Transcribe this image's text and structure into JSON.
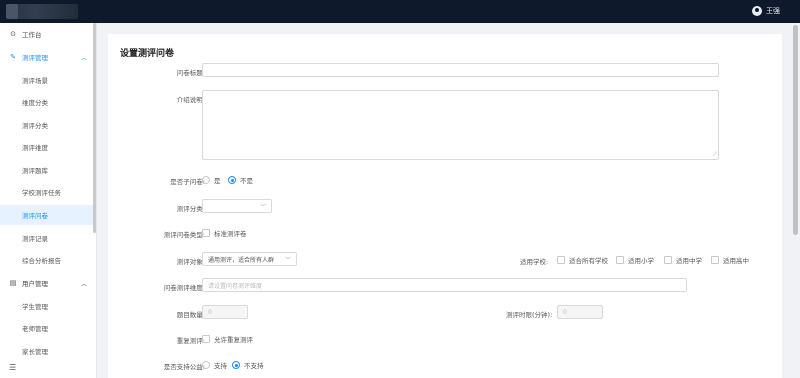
{
  "header": {
    "user_name": "王强"
  },
  "sidebar": {
    "workbench": "工作台",
    "eval_mgmt": "测评管理",
    "eval_items": [
      "测评场景",
      "维度分类",
      "测评分类",
      "测评维度",
      "测评题库",
      "学校测评任务",
      "测评问卷",
      "测评记录",
      "综合分析报告"
    ],
    "user_mgmt": "用户管理",
    "user_items": [
      "学生管理",
      "老师管理",
      "家长管理"
    ],
    "selected": "测评问卷"
  },
  "form": {
    "page_title": "设置测评问卷",
    "title_label": "问卷标题:",
    "title_value": "",
    "intro_label": "介绍说明:",
    "intro_value": "",
    "sub_label": "是否子问卷:",
    "sub_options": [
      "是",
      "不是"
    ],
    "sub_selected": "不是",
    "category_label": "测评分类:",
    "category_value": "",
    "type_label": "测评问卷类型:",
    "type_option": "标准测评卷",
    "target_label": "测评对象:",
    "target_value": "通用测评，适合所有人群",
    "school_label": "适用学校:",
    "school_options": [
      "适合所有学校",
      "适用小学",
      "适用中学",
      "适用高中"
    ],
    "dimension_label": "问卷测评维度:",
    "dimension_placeholder": "请设置问卷测评维度",
    "count_label": "题目数量:",
    "count_value": "0",
    "time_label": "测评时限(分钟):",
    "time_value": "0",
    "repeat_label": "重复测评:",
    "repeat_option": "允许重复测评",
    "public_label": "是否支持公益:",
    "public_options": [
      "支持",
      "不支持"
    ],
    "public_selected": "不支持"
  }
}
